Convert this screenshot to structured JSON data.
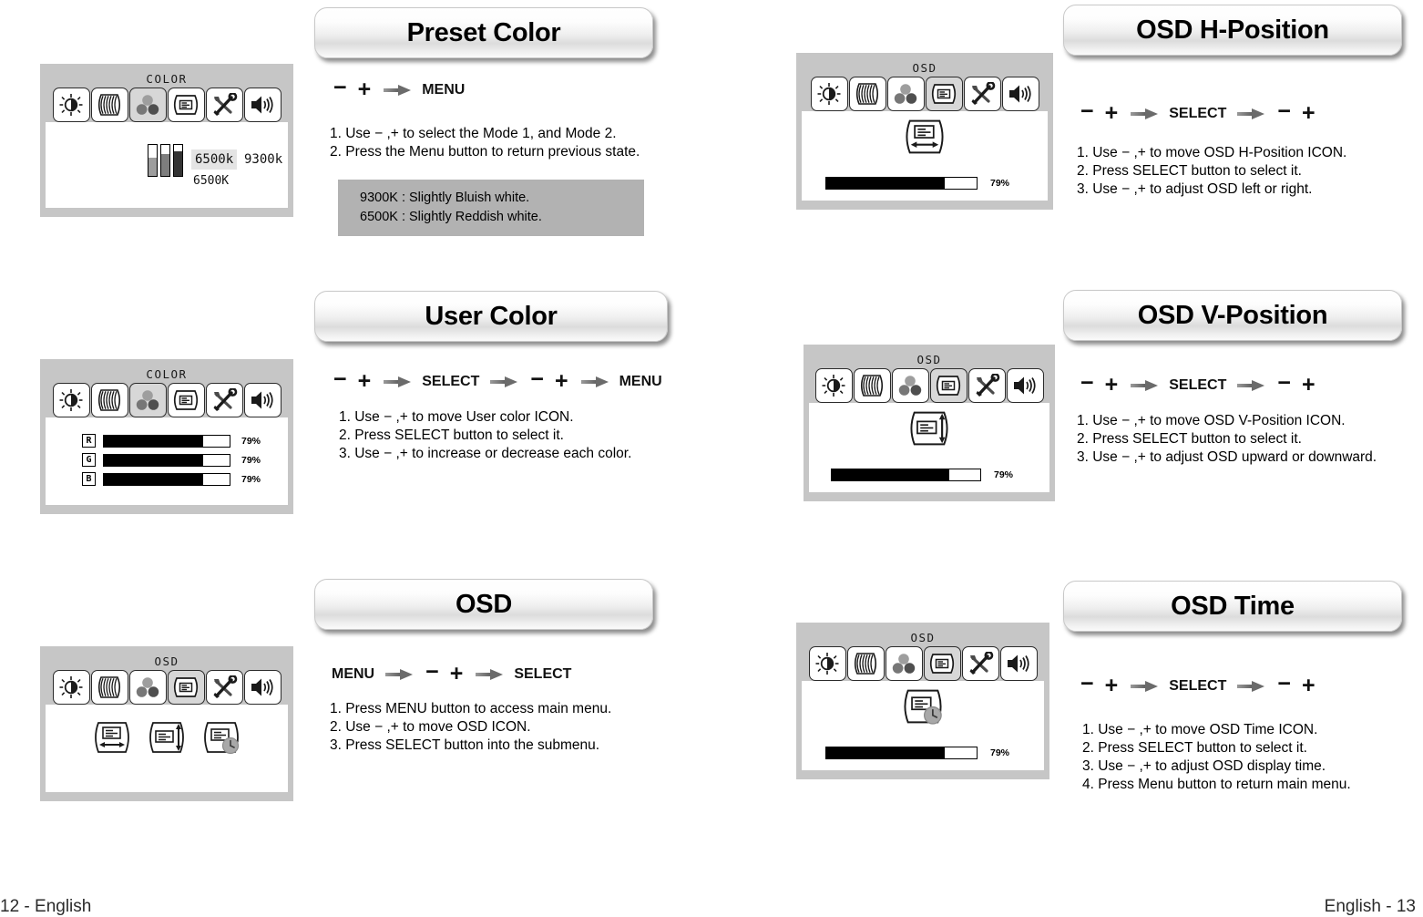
{
  "footer": {
    "left": "12 - English",
    "right": "English - 13"
  },
  "sections": [
    {
      "id": "preset-color",
      "title": "Preset Color",
      "flow": [
        "−",
        "+",
        "arrow",
        "MENU"
      ],
      "steps": [
        "1. Use − ,+ to select the Mode 1, and Mode 2.",
        "2. Press the Menu button to return previous state."
      ],
      "note": [
        "9300K : Slightly Bluish white.",
        "6500K : Slightly Reddish white."
      ],
      "osd": {
        "caption": "COLOR",
        "selected_icon": 2,
        "content": "preset",
        "options": [
          "6500k",
          "9300k"
        ],
        "selected_option": "6500k",
        "current_label": "6500K"
      }
    },
    {
      "id": "user-color",
      "title": "User Color",
      "flow": [
        "−",
        "+",
        "arrow",
        "SELECT",
        "arrow",
        "−",
        "+",
        "arrow",
        "MENU"
      ],
      "steps": [
        "1. Use − ,+ to move User color ICON.",
        "2. Press SELECT button to select it.",
        "3. Use − ,+ to increase or decrease each color."
      ],
      "osd": {
        "caption": "COLOR",
        "selected_icon": 2,
        "content": "rgb-sliders",
        "sliders": [
          {
            "tag": "R",
            "value": 79,
            "pct": "79%"
          },
          {
            "tag": "G",
            "value": 79,
            "pct": "79%"
          },
          {
            "tag": "B",
            "value": 79,
            "pct": "79%"
          }
        ]
      }
    },
    {
      "id": "osd",
      "title": "OSD",
      "flow": [
        "MENU",
        "arrow",
        "−",
        "+",
        "arrow",
        "SELECT"
      ],
      "steps": [
        "1. Press MENU button to access main menu.",
        "2. Use − ,+ to move OSD ICON.",
        "3. Press SELECT button into the submenu."
      ],
      "osd": {
        "caption": "OSD",
        "selected_icon": 3,
        "content": "osd-submenu",
        "submenu_icons": [
          "osd-h-position-icon",
          "osd-v-position-icon",
          "osd-time-icon"
        ]
      }
    },
    {
      "id": "osd-h-position",
      "title": "OSD H-Position",
      "flow": [
        "−",
        "+",
        "arrow",
        "SELECT",
        "arrow",
        "−",
        "+"
      ],
      "steps": [
        "1. Use − ,+ to move OSD H-Position ICON.",
        "2. Press SELECT button to select it.",
        "3. Use − ,+ to adjust OSD left or right."
      ],
      "osd": {
        "caption": "OSD",
        "selected_icon": 3,
        "content": "single-slider",
        "big_icon": "osd-h-position-icon",
        "slider": {
          "value": 79,
          "pct": "79%"
        }
      }
    },
    {
      "id": "osd-v-position",
      "title": "OSD V-Position",
      "flow": [
        "−",
        "+",
        "arrow",
        "SELECT",
        "arrow",
        "−",
        "+"
      ],
      "steps": [
        "1. Use − ,+ to move OSD V-Position ICON.",
        "2. Press SELECT button to select it.",
        "3. Use − ,+ to adjust OSD upward or downward."
      ],
      "osd": {
        "caption": "OSD",
        "selected_icon": 3,
        "content": "single-slider",
        "big_icon": "osd-v-position-icon",
        "slider": {
          "value": 79,
          "pct": "79%"
        }
      }
    },
    {
      "id": "osd-time",
      "title": "OSD Time",
      "flow": [
        "−",
        "+",
        "arrow",
        "SELECT",
        "arrow",
        "−",
        "+"
      ],
      "steps": [
        "1. Use − ,+ to move OSD Time ICON.",
        "2. Press SELECT button to select it.",
        "3. Use − ,+ to adjust OSD display time.",
        "4. Press Menu button to return main menu."
      ],
      "osd": {
        "caption": "OSD",
        "selected_icon": 3,
        "content": "single-slider",
        "big_icon": "osd-time-icon",
        "slider": {
          "value": 79,
          "pct": "79%"
        }
      }
    }
  ],
  "menu_icons": [
    "brightness-contrast-icon",
    "geometry-moire-icon",
    "color-icon",
    "osd-icon",
    "tools-icon",
    "volume-icon"
  ]
}
